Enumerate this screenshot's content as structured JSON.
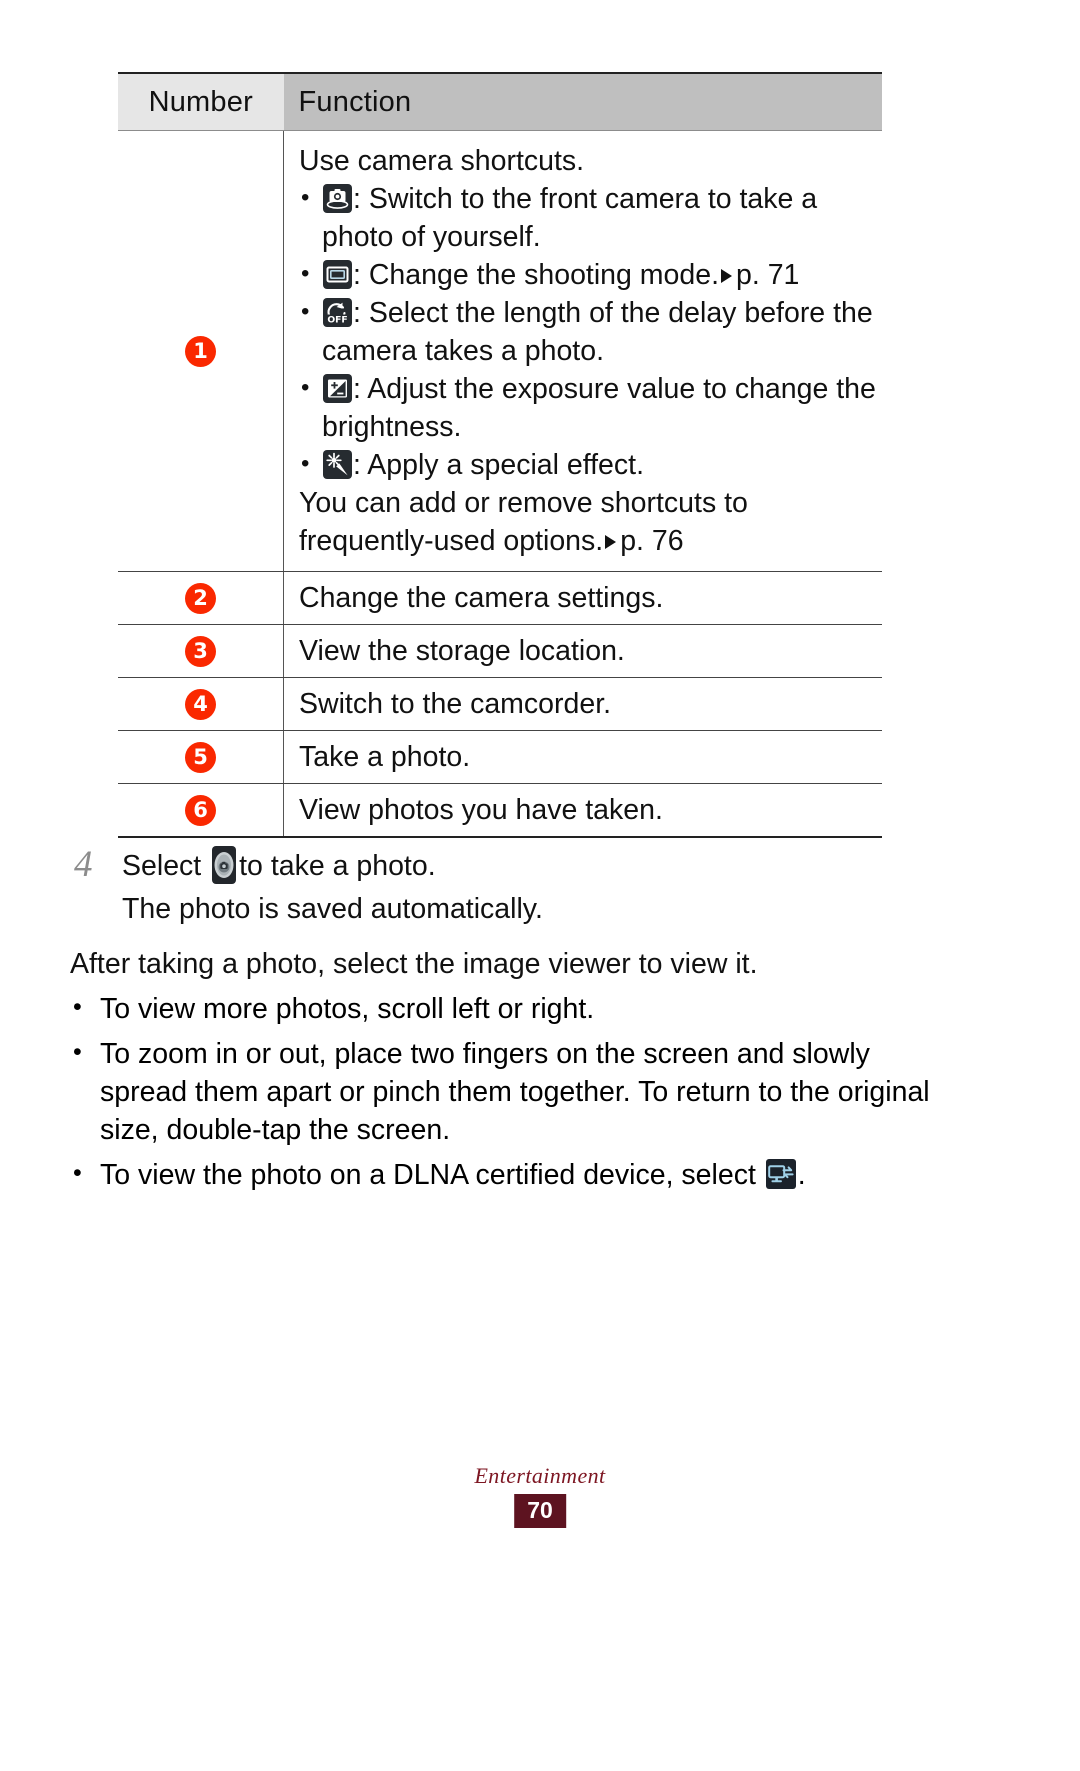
{
  "table": {
    "headers": {
      "number": "Number",
      "function": "Function"
    },
    "rows": [
      {
        "number": "1",
        "intro": "Use camera shortcuts.",
        "bullets": [
          {
            "icon": "front-camera-icon",
            "text": ": Switch to the front camera to take a photo of yourself."
          },
          {
            "icon": "shooting-mode-icon",
            "text": ": Change the shooting mode.",
            "ref": "p. 71"
          },
          {
            "icon": "timer-off-icon",
            "text": ": Select the length of the delay before the camera takes a photo."
          },
          {
            "icon": "exposure-icon",
            "text": ": Adjust the exposure value to change the brightness."
          },
          {
            "icon": "special-effect-icon",
            "text": ": Apply a special effect."
          }
        ],
        "outro": "You can add or remove shortcuts to frequently-used options.",
        "outro_ref": "p. 76"
      },
      {
        "number": "2",
        "text": "Change the camera settings."
      },
      {
        "number": "3",
        "text": "View the storage location."
      },
      {
        "number": "4",
        "text": "Switch to the camcorder."
      },
      {
        "number": "5",
        "text": "Take a photo."
      },
      {
        "number": "6",
        "text": "View photos you have taken."
      }
    ]
  },
  "step": {
    "number": "4",
    "before_icon": "Select",
    "icon": "shutter-button-icon",
    "after_icon": "to take a photo.",
    "sub": "The photo is saved automatically."
  },
  "paragraph": "After taking a photo, select the image viewer to view it.",
  "bullets": [
    {
      "text": "To view more photos, scroll left or right."
    },
    {
      "text": "To zoom in or out, place two fingers on the screen and slowly spread them apart or pinch them together. To return to the original size, double-tap the screen."
    },
    {
      "before": "To view the photo on a DLNA certified device, select",
      "icon": "dlna-icon",
      "after": "."
    }
  ],
  "footer": {
    "section": "Entertainment",
    "page": "70"
  },
  "colors": {
    "circle_number": "#fa2800",
    "header_number_bg": "#e6e6e6",
    "header_function_bg": "#bfbfbf",
    "footer_section": "#7d1622",
    "footer_page_bg": "#5d1320",
    "icon_bg": "#262b30"
  }
}
